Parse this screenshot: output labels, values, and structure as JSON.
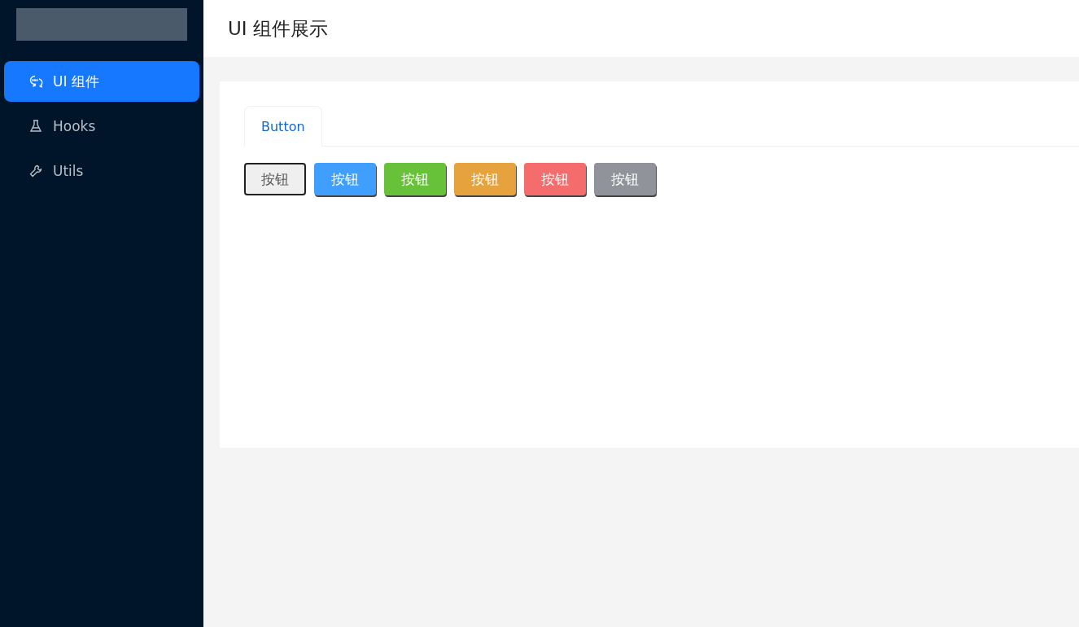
{
  "sidebar": {
    "items": [
      {
        "label": "UI 组件",
        "kind": "chat",
        "selected": true
      },
      {
        "label": "Hooks",
        "kind": "flask",
        "selected": false
      },
      {
        "label": "Utils",
        "kind": "wrench",
        "selected": false
      }
    ]
  },
  "header": {
    "title": "UI 组件展示"
  },
  "tabs": [
    {
      "label": "Button",
      "selected": true
    }
  ],
  "buttons": [
    {
      "label": "按钮",
      "kind": "default"
    },
    {
      "label": "按钮",
      "kind": "primary"
    },
    {
      "label": "按钮",
      "kind": "success"
    },
    {
      "label": "按钮",
      "kind": "warning"
    },
    {
      "label": "按钮",
      "kind": "danger"
    },
    {
      "label": "按钮",
      "kind": "info"
    }
  ]
}
